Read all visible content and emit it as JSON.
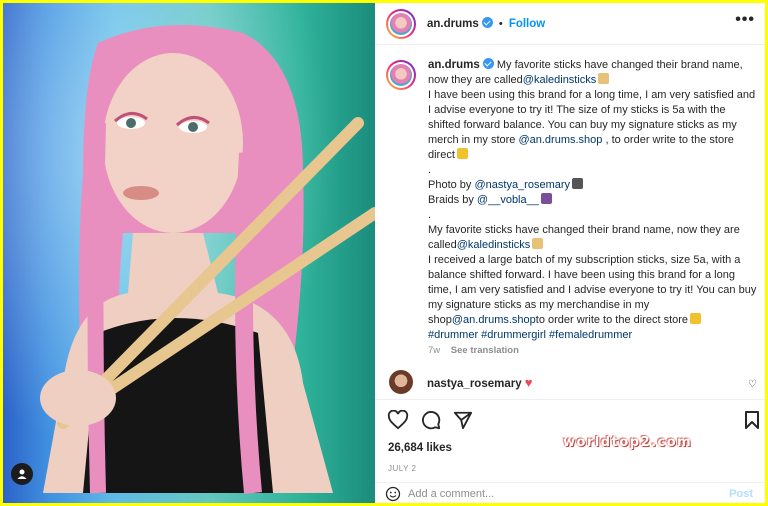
{
  "header": {
    "username": "an.drums",
    "separator": "•",
    "follow_label": "Follow",
    "more_label": "•••"
  },
  "caption": {
    "username": "an.drums",
    "lines": {
      "l1": "My favorite sticks have changed their brand name, now they are called",
      "l1_link": "@kaledinsticks",
      "l2": "I have been using this brand for a long time, I am very satisfied and I advise everyone to try it! The size of my sticks is 5a with the shifted forward balance. You can buy my signature sticks as my merch in my store ",
      "l2_link": "@an.drums.shop",
      "l2_end": " , to order write to the store direct",
      "dot1": ".",
      "photo_by": "Photo by ",
      "photo_link": "@nastya_rosemary",
      "braids_by": "Braids by ",
      "braids_link": "@__vobla__",
      "dot2": ".",
      "l3": "My favorite sticks have changed their brand name, now they are called",
      "l3_link": "@kaledinsticks",
      "l4": "I received a large batch of my subscription sticks, size 5a, with a balance shifted forward. I have been using this brand for a long time, I am very satisfied and I advise everyone to try it! You can buy my signature sticks as my merchandise in my shop",
      "l4_link": "@an.drums.shop",
      "l4_end": "to order write to the direct store",
      "tags": "#drummer #drummergirl #femaledrummer"
    },
    "age": "7w",
    "see_translation": "See translation"
  },
  "comment": {
    "username": "nastya_rosemary",
    "heart": "♥",
    "like_heart": "♡"
  },
  "likes": "26,684 likes",
  "date": "JULY 2",
  "watermark": "worldtop2.com",
  "add_comment": {
    "placeholder": "Add a comment...",
    "post_label": "Post"
  },
  "colors": {
    "link": "#00376b",
    "follow": "#0095f6",
    "frame": "#ffff00"
  }
}
